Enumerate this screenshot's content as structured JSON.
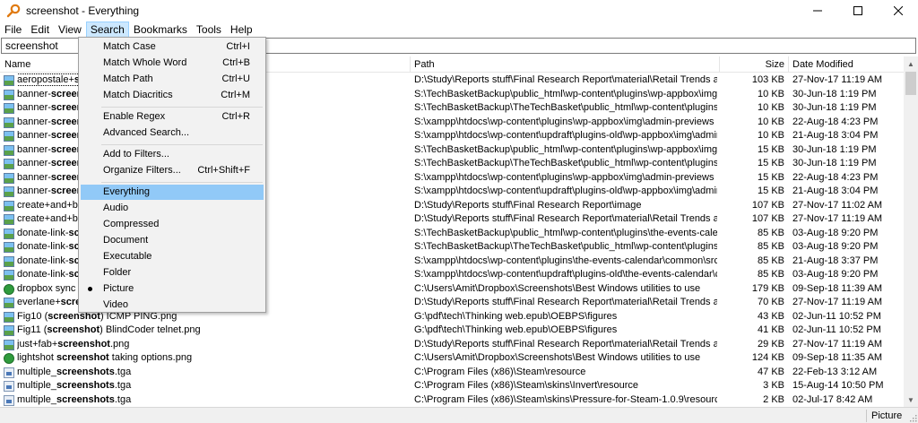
{
  "window": {
    "title": "screenshot - Everything",
    "icon": "magnifier-key-icon",
    "controls": [
      "minimize-icon",
      "maximize-icon",
      "close-icon"
    ]
  },
  "menubar": [
    "File",
    "Edit",
    "View",
    "Search",
    "Bookmarks",
    "Tools",
    "Help"
  ],
  "search": {
    "value": "screenshot"
  },
  "columns": {
    "name": "Name",
    "path": "Path",
    "size": "Size",
    "date": "Date Modified"
  },
  "rows": [
    {
      "icon": "image-file-icon",
      "name_pre": "aeropostale+",
      "name_bold": "scr",
      "name_post": "",
      "path": "D:\\Study\\Reports stuff\\Final Research Report\\material\\Retail Trends and Pred...",
      "size": "103 KB",
      "date": "27-Nov-17 11:19 AM"
    },
    {
      "icon": "image-file-icon",
      "name_pre": "banner-",
      "name_bold": "screens",
      "name_post": "",
      "path": "S:\\TechBasketBackup\\public_html\\wp-content\\plugins\\wp-appbox\\img\\ad...",
      "size": "10 KB",
      "date": "30-Jun-18 1:19 PM"
    },
    {
      "icon": "image-file-icon",
      "name_pre": "banner-",
      "name_bold": "screens",
      "name_post": "",
      "path": "S:\\TechBasketBackup\\TheTechBasket\\public_html\\wp-content\\plugins\\wp-a...",
      "size": "10 KB",
      "date": "30-Jun-18 1:19 PM"
    },
    {
      "icon": "image-file-icon",
      "name_pre": "banner-",
      "name_bold": "screens",
      "name_post": "",
      "path": "S:\\xampp\\htdocs\\wp-content\\plugins\\wp-appbox\\img\\admin-previews",
      "size": "10 KB",
      "date": "22-Aug-18 4:23 PM"
    },
    {
      "icon": "image-file-icon",
      "name_pre": "banner-",
      "name_bold": "screens",
      "name_post": "",
      "path": "S:\\xampp\\htdocs\\wp-content\\updraft\\plugins-old\\wp-appbox\\img\\admin-...",
      "size": "10 KB",
      "date": "21-Aug-18 3:04 PM"
    },
    {
      "icon": "image-file-icon",
      "name_pre": "banner-",
      "name_bold": "screens",
      "name_post": "",
      "path": "S:\\TechBasketBackup\\public_html\\wp-content\\plugins\\wp-appbox\\img\\ad...",
      "size": "15 KB",
      "date": "30-Jun-18 1:19 PM"
    },
    {
      "icon": "image-file-icon",
      "name_pre": "banner-",
      "name_bold": "screens",
      "name_post": "",
      "path": "S:\\TechBasketBackup\\TheTechBasket\\public_html\\wp-content\\plugins\\wp-a...",
      "size": "15 KB",
      "date": "30-Jun-18 1:19 PM"
    },
    {
      "icon": "image-file-icon",
      "name_pre": "banner-",
      "name_bold": "screens",
      "name_post": "",
      "path": "S:\\xampp\\htdocs\\wp-content\\plugins\\wp-appbox\\img\\admin-previews",
      "size": "15 KB",
      "date": "22-Aug-18 4:23 PM"
    },
    {
      "icon": "image-file-icon",
      "name_pre": "banner-",
      "name_bold": "screens",
      "name_post": "",
      "path": "S:\\xampp\\htdocs\\wp-content\\updraft\\plugins-old\\wp-appbox\\img\\admin-...",
      "size": "15 KB",
      "date": "21-Aug-18 3:04 PM"
    },
    {
      "icon": "image-file-icon",
      "name_pre": "create+and+ba",
      "name_bold": "",
      "name_post": "",
      "path": "D:\\Study\\Reports stuff\\Final Research Report\\image",
      "size": "107 KB",
      "date": "27-Nov-17 11:02 AM"
    },
    {
      "icon": "image-file-icon",
      "name_pre": "create+and+ba",
      "name_bold": "",
      "name_post": "",
      "path": "D:\\Study\\Reports stuff\\Final Research Report\\material\\Retail Trends and Pred...",
      "size": "107 KB",
      "date": "27-Nov-17 11:19 AM"
    },
    {
      "icon": "image-file-icon",
      "name_pre": "donate-link-",
      "name_bold": "scr",
      "name_post": "",
      "path": "S:\\TechBasketBackup\\public_html\\wp-content\\plugins\\the-events-calendar\\...",
      "size": "85 KB",
      "date": "03-Aug-18 9:20 PM"
    },
    {
      "icon": "image-file-icon",
      "name_pre": "donate-link-",
      "name_bold": "scr",
      "name_post": "",
      "path": "S:\\TechBasketBackup\\TheTechBasket\\public_html\\wp-content\\plugins\\the-...",
      "size": "85 KB",
      "date": "03-Aug-18 9:20 PM"
    },
    {
      "icon": "image-file-icon",
      "name_pre": "donate-link-",
      "name_bold": "scr",
      "name_post": "",
      "path": "S:\\xampp\\htdocs\\wp-content\\plugins\\the-events-calendar\\common\\src\\res...",
      "size": "85 KB",
      "date": "21-Aug-18 3:37 PM"
    },
    {
      "icon": "image-file-icon",
      "name_pre": "donate-link-",
      "name_bold": "scr",
      "name_post": "",
      "path": "S:\\xampp\\htdocs\\wp-content\\updraft\\plugins-old\\the-events-calendar\\co...",
      "size": "85 KB",
      "date": "03-Aug-18 9:20 PM"
    },
    {
      "icon": "app-file-icon",
      "name_pre": "dropbox sync ",
      "name_bold": "sc",
      "name_post": "",
      "path": "C:\\Users\\Amit\\Dropbox\\Screenshots\\Best Windows utilities to use",
      "size": "179 KB",
      "date": "09-Sep-18 11:39 AM"
    },
    {
      "icon": "image-file-icon",
      "name_pre": "everlane+",
      "name_bold": "scre",
      "name_post": "",
      "path": "D:\\Study\\Reports stuff\\Final Research Report\\material\\Retail Trends and Pred...",
      "size": "70 KB",
      "date": "27-Nov-17 11:19 AM"
    },
    {
      "icon": "image-file-icon",
      "name_pre": "Fig10 (",
      "name_bold": "screenshot",
      "name_post": ") ICMP PING.png",
      "path": "G:\\pdf\\tech\\Thinking web.epub\\OEBPS\\figures",
      "size": "43 KB",
      "date": "02-Jun-11 10:52 PM"
    },
    {
      "icon": "image-file-icon",
      "name_pre": "Fig11 (",
      "name_bold": "screenshot",
      "name_post": ") BlindCoder telnet.png",
      "path": "G:\\pdf\\tech\\Thinking web.epub\\OEBPS\\figures",
      "size": "41 KB",
      "date": "02-Jun-11 10:52 PM"
    },
    {
      "icon": "image-file-icon",
      "name_pre": "just+fab+",
      "name_bold": "screenshot",
      "name_post": ".png",
      "path": "D:\\Study\\Reports stuff\\Final Research Report\\material\\Retail Trends and Pred...",
      "size": "29 KB",
      "date": "27-Nov-17 11:19 AM"
    },
    {
      "icon": "app-file-icon",
      "name_pre": "lightshot ",
      "name_bold": "screenshot",
      "name_post": " taking options.png",
      "path": "C:\\Users\\Amit\\Dropbox\\Screenshots\\Best Windows utilities to use",
      "size": "124 KB",
      "date": "09-Sep-18 11:35 AM"
    },
    {
      "icon": "tga-file-icon",
      "name_pre": "multiple_",
      "name_bold": "screenshots",
      "name_post": ".tga",
      "path": "C:\\Program Files (x86)\\Steam\\resource",
      "size": "47 KB",
      "date": "22-Feb-13 3:12 AM"
    },
    {
      "icon": "tga-file-icon",
      "name_pre": "multiple_",
      "name_bold": "screenshots",
      "name_post": ".tga",
      "path": "C:\\Program Files (x86)\\Steam\\skins\\Invert\\resource",
      "size": "3 KB",
      "date": "15-Aug-14 10:50 PM"
    },
    {
      "icon": "tga-file-icon",
      "name_pre": "multiple_",
      "name_bold": "screenshots",
      "name_post": ".tga",
      "path": "C:\\Program Files (x86)\\Steam\\skins\\Pressure-for-Steam-1.0.9\\resource",
      "size": "2 KB",
      "date": "02-Jul-17 8:42 AM"
    }
  ],
  "search_menu": [
    {
      "label": "Match Case",
      "shortcut": "Ctrl+I"
    },
    {
      "label": "Match Whole Word",
      "shortcut": "Ctrl+B"
    },
    {
      "label": "Match Path",
      "shortcut": "Ctrl+U"
    },
    {
      "label": "Match Diacritics",
      "shortcut": "Ctrl+M"
    },
    {
      "separator": true
    },
    {
      "label": "Enable Regex",
      "shortcut": "Ctrl+R"
    },
    {
      "label": "Advanced Search...",
      "shortcut": ""
    },
    {
      "separator": true
    },
    {
      "label": "Add to Filters...",
      "shortcut": ""
    },
    {
      "label": "Organize Filters...",
      "shortcut": "Ctrl+Shift+F"
    },
    {
      "separator": true
    },
    {
      "label": "Everything",
      "shortcut": "",
      "highlighted": true
    },
    {
      "label": "Audio",
      "shortcut": ""
    },
    {
      "label": "Compressed",
      "shortcut": ""
    },
    {
      "label": "Document",
      "shortcut": ""
    },
    {
      "label": "Executable",
      "shortcut": ""
    },
    {
      "label": "Folder",
      "shortcut": ""
    },
    {
      "label": "Picture",
      "shortcut": "",
      "checked": true
    },
    {
      "label": "Video",
      "shortcut": ""
    }
  ],
  "status": {
    "filter": "Picture"
  },
  "colors": {
    "menu_highlight": "#91c9f7",
    "active_menu": "#cce8ff"
  }
}
